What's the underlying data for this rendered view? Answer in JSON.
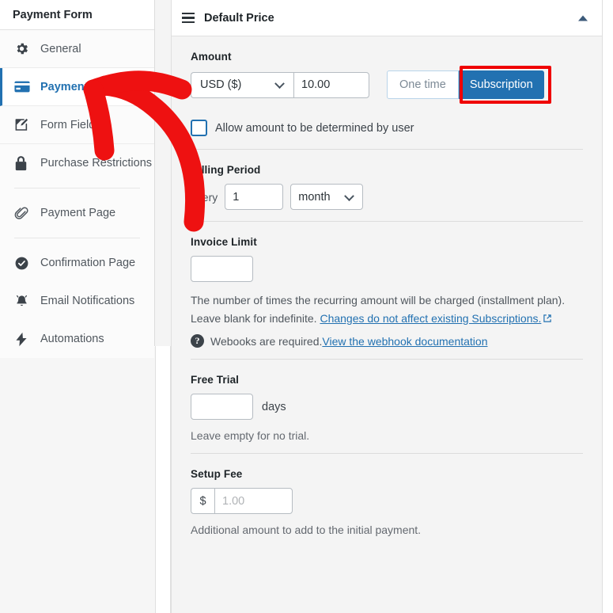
{
  "sidebar": {
    "title": "Payment Form",
    "items": [
      {
        "label": "General",
        "icon": "gear-icon",
        "active": false
      },
      {
        "label": "Payment",
        "icon": "credit-card-icon",
        "active": true
      },
      {
        "label": "Form Fields",
        "icon": "edit-square-icon",
        "active": false
      },
      {
        "label": "Purchase Restrictions",
        "icon": "lock-icon",
        "active": false
      },
      {
        "label": "Payment Page",
        "icon": "paperclip-icon",
        "active": false
      },
      {
        "label": "Confirmation Page",
        "icon": "check-circle-icon",
        "active": false
      },
      {
        "label": "Email Notifications",
        "icon": "bell-icon",
        "active": false
      },
      {
        "label": "Automations",
        "icon": "lightning-bolt-icon",
        "active": false
      }
    ]
  },
  "panel": {
    "menu_icon": "hamburger-icon",
    "title": "Default Price",
    "collapse_icon": "caret-up-icon",
    "amount": {
      "label": "Amount",
      "currency_value": "USD ($)",
      "currency_options": [
        "USD ($)"
      ],
      "amount_value": "10.00",
      "one_time_label": "One time",
      "subscription_label": "Subscription",
      "selected_mode": "Subscription",
      "highlight_color": "#ef0000",
      "accent_color": "#2271b1"
    },
    "allow_user_amount": {
      "label": "Allow amount to be determined by user",
      "checked": false
    },
    "billing_period": {
      "label": "Billing Period",
      "every_label": "every",
      "interval_value": "1",
      "period_value": "month",
      "period_options": [
        "month"
      ]
    },
    "invoice_limit": {
      "label": "Invoice Limit",
      "value": "",
      "help_part1": "The number of times the recurring amount will be charged (installment plan). Leave blank for indefinite. ",
      "help_link": "Changes do not affect existing Subscriptions.",
      "external_icon": "external-link-icon",
      "webhook_icon": "question-mark-icon",
      "webhook_text": "Webooks are required. ",
      "webhook_link": "View the webhook documentation"
    },
    "free_trial": {
      "label": "Free Trial",
      "value": "",
      "unit": "days",
      "note": "Leave empty for no trial."
    },
    "setup_fee": {
      "label": "Setup Fee",
      "prefix": "$",
      "placeholder": "1.00",
      "value": "",
      "note": "Additional amount to add to the initial payment."
    }
  },
  "annotation": {
    "arrow_color": "#ee1111",
    "points_to": "Payment"
  }
}
